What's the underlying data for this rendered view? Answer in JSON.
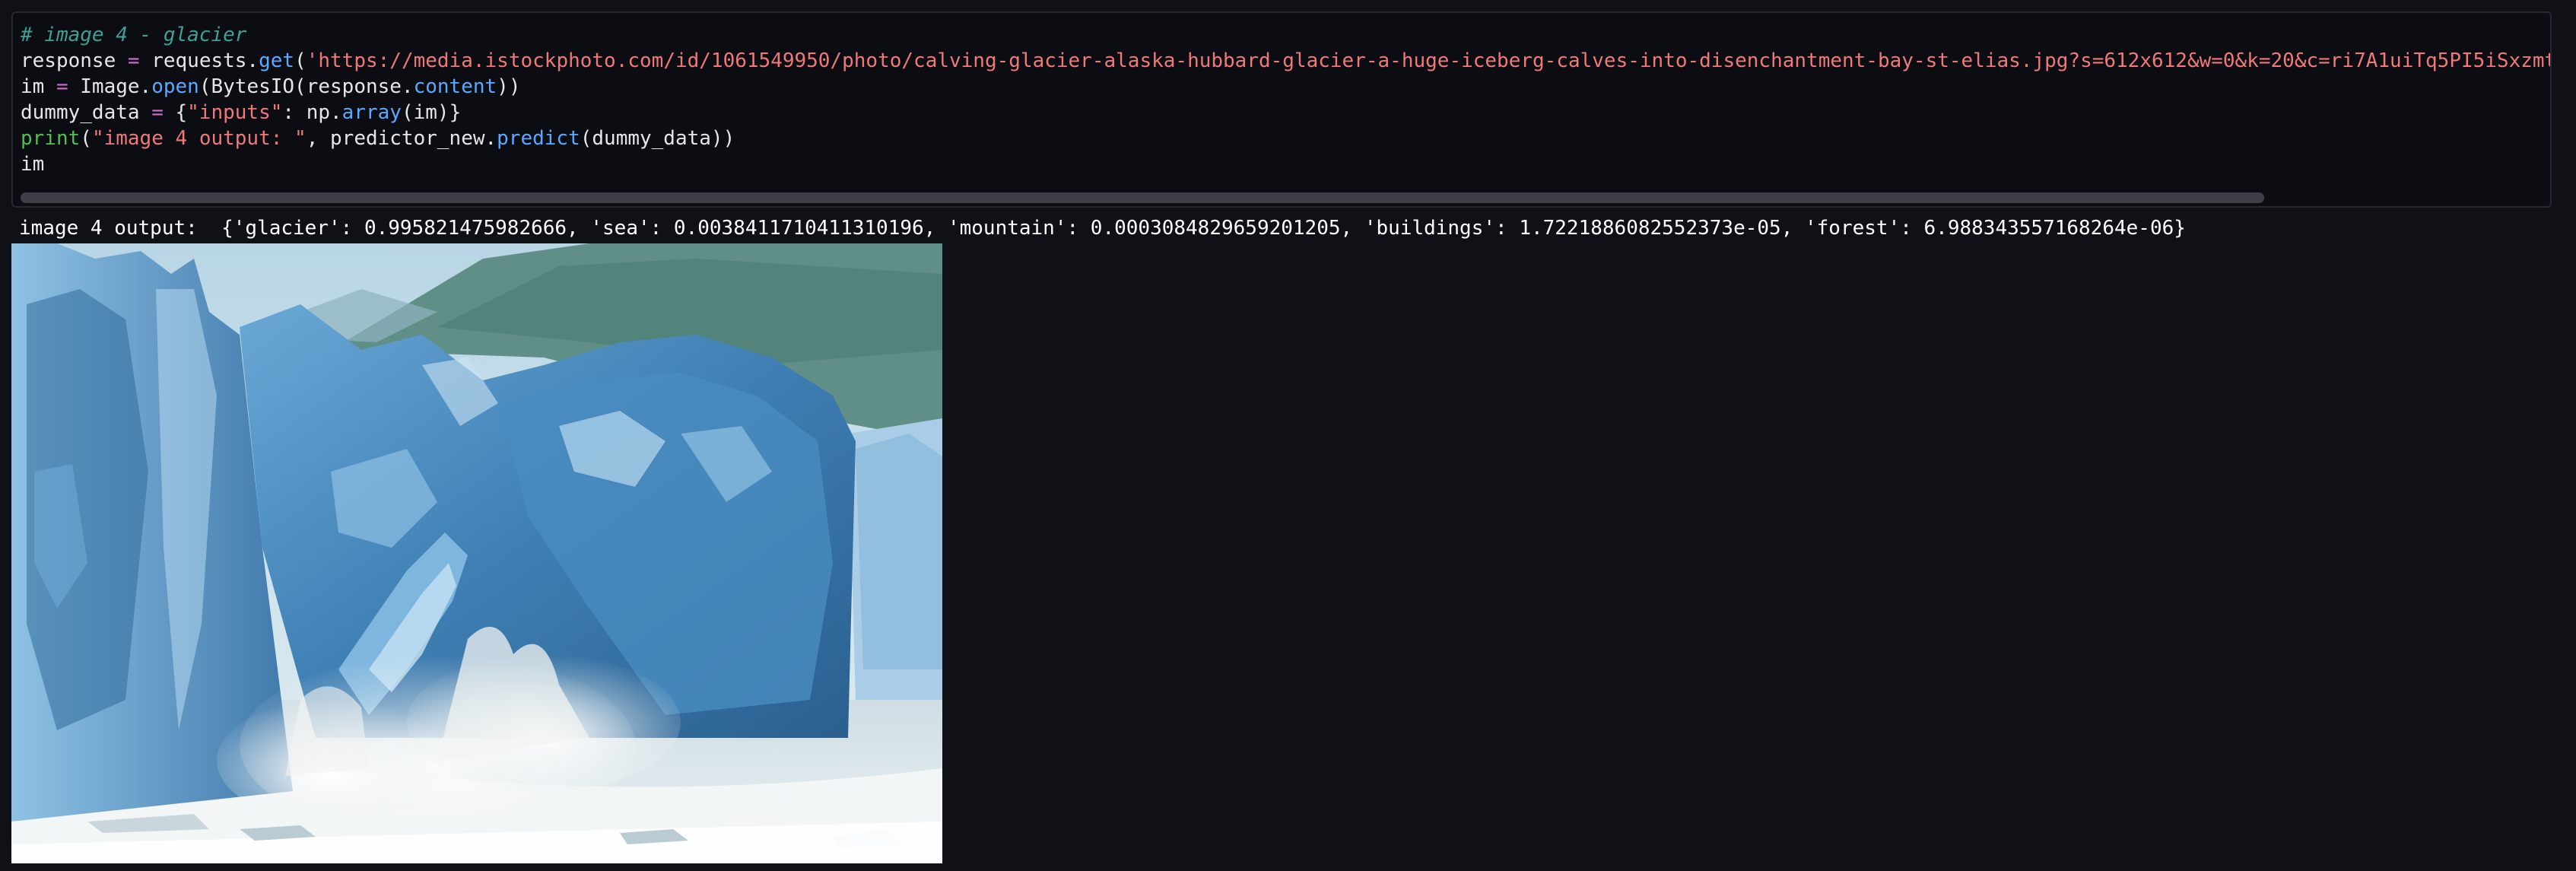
{
  "cell": {
    "code_lines": {
      "l1_comment": "# image 4 - glacier",
      "l2_a": "response ",
      "l2_op": "=",
      "l2_b": " requests.",
      "l2_fn": "get",
      "l2_c": "(",
      "l2_str": "'https://media.istockphoto.com/id/1061549950/photo/calving-glacier-alaska-hubbard-glacier-a-huge-iceberg-calves-into-disenchantment-bay-st-elias.jpg?s=612x612&w=0&k=20&c=ri7A1uiTq5PI5iSxzmt",
      "l3_a": "im ",
      "l3_op": "=",
      "l3_b": " Image.",
      "l3_fn": "open",
      "l3_c": "(BytesIO(response.",
      "l3_fn2": "content",
      "l3_d": "))",
      "l4_a": "dummy_data ",
      "l4_op": "=",
      "l4_b": " {",
      "l4_str": "\"inputs\"",
      "l4_c": ": np.",
      "l4_fn": "array",
      "l4_d": "(im)}",
      "l5_builtin": "print",
      "l5_a": "(",
      "l5_str": "\"image 4 output: \"",
      "l5_b": ", predictor_new.",
      "l5_fn": "predict",
      "l5_c": "(dummy_data))",
      "l6": "im"
    }
  },
  "output": {
    "text": "image 4 output:  {'glacier': 0.995821475982666, 'sea': 0.0038411710411310196, 'mountain': 0.0003084829659201205, 'buildings': 1.7221886082552373e-05, 'forest': 6.988343557168264e-06}"
  },
  "image": {
    "subject": "calving glacier photo",
    "colors": {
      "sky": "#cfe3ec",
      "mountain": "#5f8f86",
      "ice_dark": "#2f6b9a",
      "ice_mid": "#4f8fc0",
      "ice_light": "#a9d0ea",
      "spray": "#eef3f3",
      "water": "#dfe8ec"
    }
  }
}
